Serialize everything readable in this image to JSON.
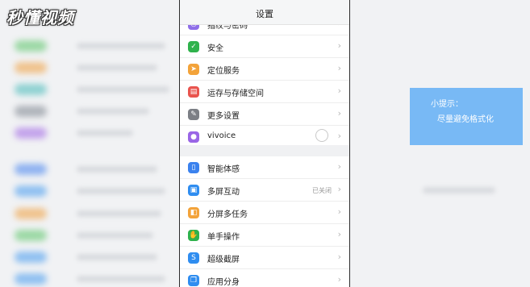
{
  "watermark": "秒懂视频",
  "header": {
    "title": "设置"
  },
  "group1": [
    {
      "label": "指纹与密码",
      "icon": "fingerprint-icon",
      "color": "#8e6ee8",
      "glyph": "◎"
    },
    {
      "label": "安全",
      "icon": "shield-icon",
      "color": "#2fb24c",
      "glyph": "✓"
    },
    {
      "label": "定位服务",
      "icon": "location-arrow-icon",
      "color": "#f3a33a",
      "glyph": "➤"
    },
    {
      "label": "运存与存储空间",
      "icon": "storage-icon",
      "color": "#e9544e",
      "glyph": "▤"
    },
    {
      "label": "更多设置",
      "icon": "wrench-icon",
      "color": "#7c7f85",
      "glyph": "✎"
    },
    {
      "label": "vivoice",
      "icon": "microphone-icon",
      "color": "#9a66e6",
      "glyph": "●"
    }
  ],
  "group2": [
    {
      "label": "智能体感",
      "icon": "phone-sensor-icon",
      "color": "#3b82ee",
      "glyph": "▯",
      "status": ""
    },
    {
      "label": "多屏互动",
      "icon": "multi-screen-icon",
      "color": "#2f8df0",
      "glyph": "▣",
      "status": "已关闭"
    },
    {
      "label": "分屏多任务",
      "icon": "split-screen-icon",
      "color": "#f3a33a",
      "glyph": "◧",
      "status": ""
    },
    {
      "label": "单手操作",
      "icon": "one-hand-icon",
      "color": "#2fb24c",
      "glyph": "✋",
      "status": ""
    },
    {
      "label": "超级截屏",
      "icon": "screenshot-icon",
      "color": "#2f8df0",
      "glyph": "S",
      "status": ""
    },
    {
      "label": "应用分身",
      "icon": "app-clone-icon",
      "color": "#2f8df0",
      "glyph": "❐",
      "status": ""
    }
  ],
  "chevron": "›",
  "tip": {
    "title": "小提示：",
    "text": "尽量避免格式化"
  }
}
